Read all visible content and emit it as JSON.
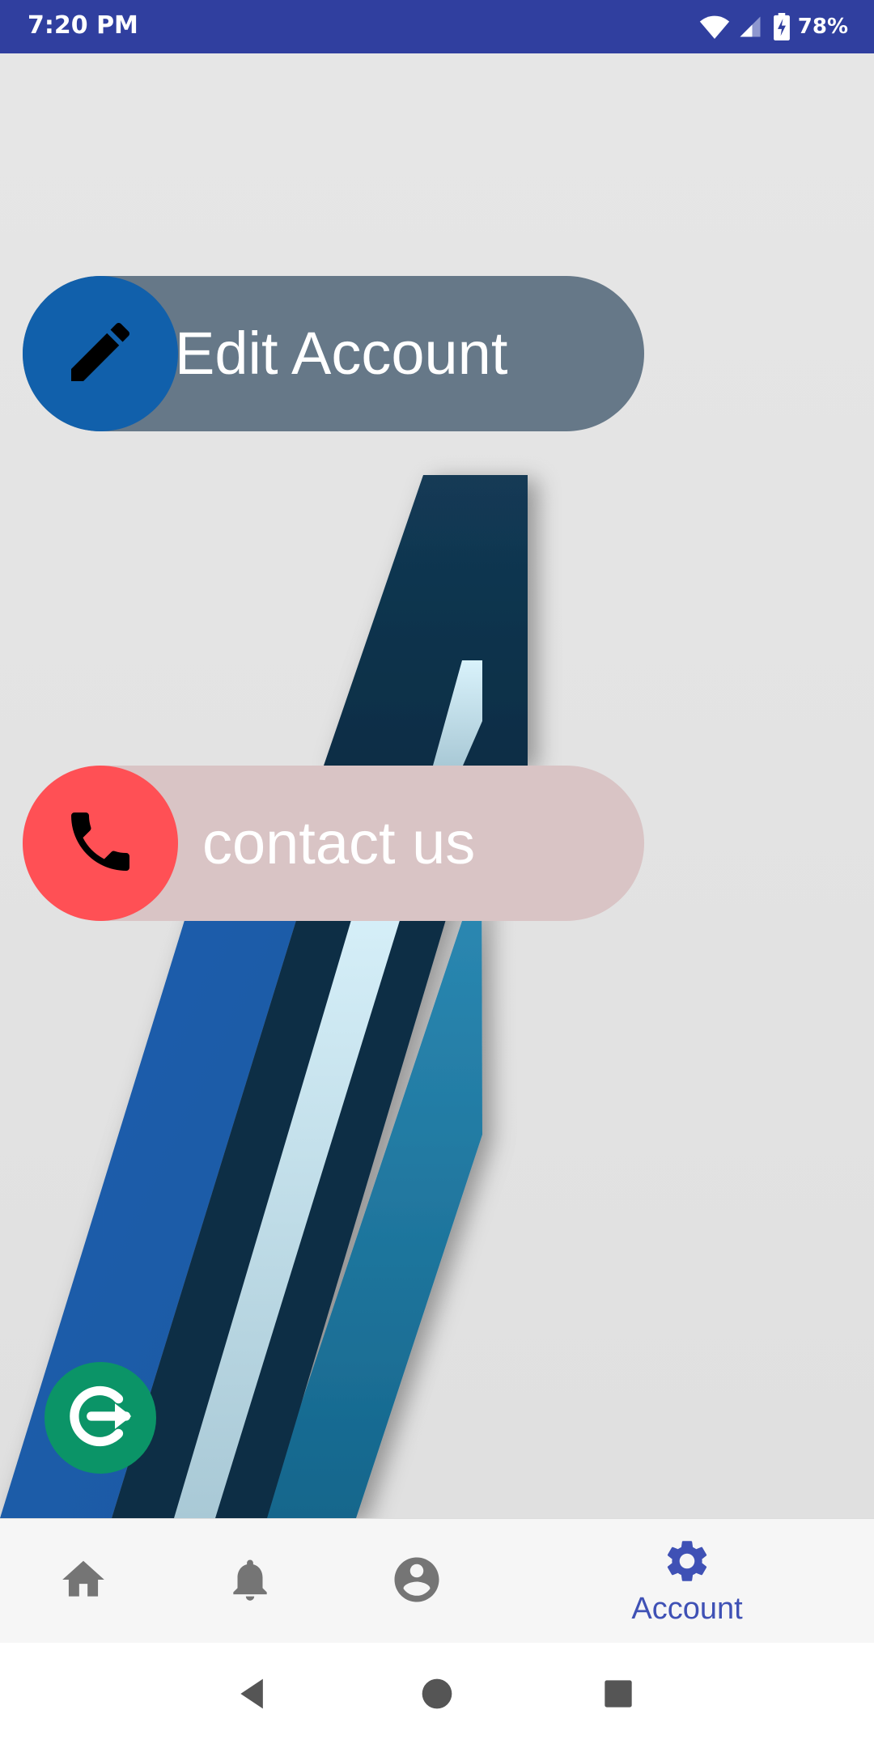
{
  "status_bar": {
    "time": "7:20 PM",
    "battery_percent": "78%",
    "icons": [
      "wifi-icon",
      "cellular-signal-icon",
      "battery-charging-icon"
    ],
    "background_color": "#303f9f"
  },
  "menu": {
    "edit_account": {
      "label": "Edit Account",
      "icon": "pencil-icon",
      "circle_color": "#1160ab",
      "pill_color": "#667888"
    },
    "contact_us": {
      "label": "contact us",
      "icon": "phone-icon",
      "circle_color": "#ff5055",
      "pill_color": "#d9c4c5"
    }
  },
  "logout_button": {
    "icon": "logout-icon",
    "color": "#0b9467"
  },
  "bottom_nav": {
    "active_color": "#3f51b5",
    "items": [
      {
        "name": "home",
        "icon": "home-icon",
        "label": "",
        "active": false
      },
      {
        "name": "notifications",
        "icon": "bell-icon",
        "label": "",
        "active": false
      },
      {
        "name": "profile",
        "icon": "account-circle-icon",
        "label": "",
        "active": false
      },
      {
        "name": "account",
        "icon": "gear-icon",
        "label": "Account",
        "active": true
      }
    ]
  },
  "system_nav": {
    "icons": [
      "back-icon",
      "home-circle-icon",
      "recents-icon"
    ]
  }
}
